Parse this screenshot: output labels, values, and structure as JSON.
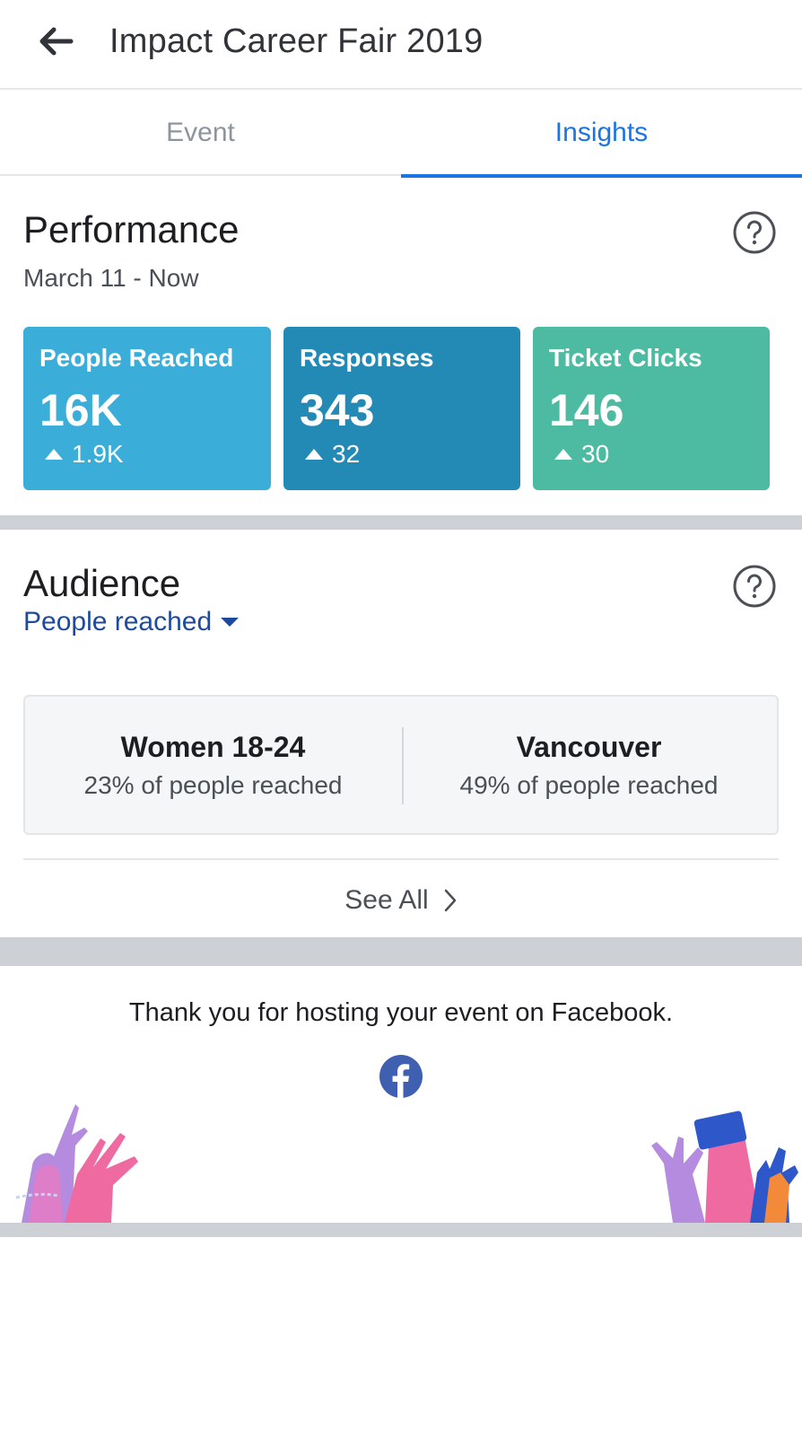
{
  "header": {
    "title": "Impact Career Fair 2019",
    "back_icon": "arrow-left-icon"
  },
  "tabs": [
    {
      "label": "Event",
      "active": false
    },
    {
      "label": "Insights",
      "active": true
    }
  ],
  "performance": {
    "title": "Performance",
    "date_range": "March 11 - Now",
    "help_icon": "question-circle-icon",
    "cards": [
      {
        "label": "People Reached",
        "value": "16K",
        "delta": "1.9K",
        "color": "#3aaed8"
      },
      {
        "label": "Responses",
        "value": "343",
        "delta": "32",
        "color": "#238ab5"
      },
      {
        "label": "Ticket Clicks",
        "value": "146",
        "delta": "30",
        "color": "#4dbba1"
      }
    ]
  },
  "audience": {
    "title": "Audience",
    "dropdown_label": "People reached",
    "help_icon": "question-circle-icon",
    "items": [
      {
        "name": "Women 18-24",
        "pct": "23% of people reached"
      },
      {
        "name": "Vancouver",
        "pct": "49% of people reached"
      }
    ],
    "see_all": "See All"
  },
  "footer": {
    "thanks": "Thank you for hosting your event on Facebook.",
    "logo_icon": "facebook-logo-icon"
  },
  "colors": {
    "accent_blue": "#1b74e4",
    "link_blue": "#1d4a9d",
    "band_gray": "#cdd0d4"
  }
}
